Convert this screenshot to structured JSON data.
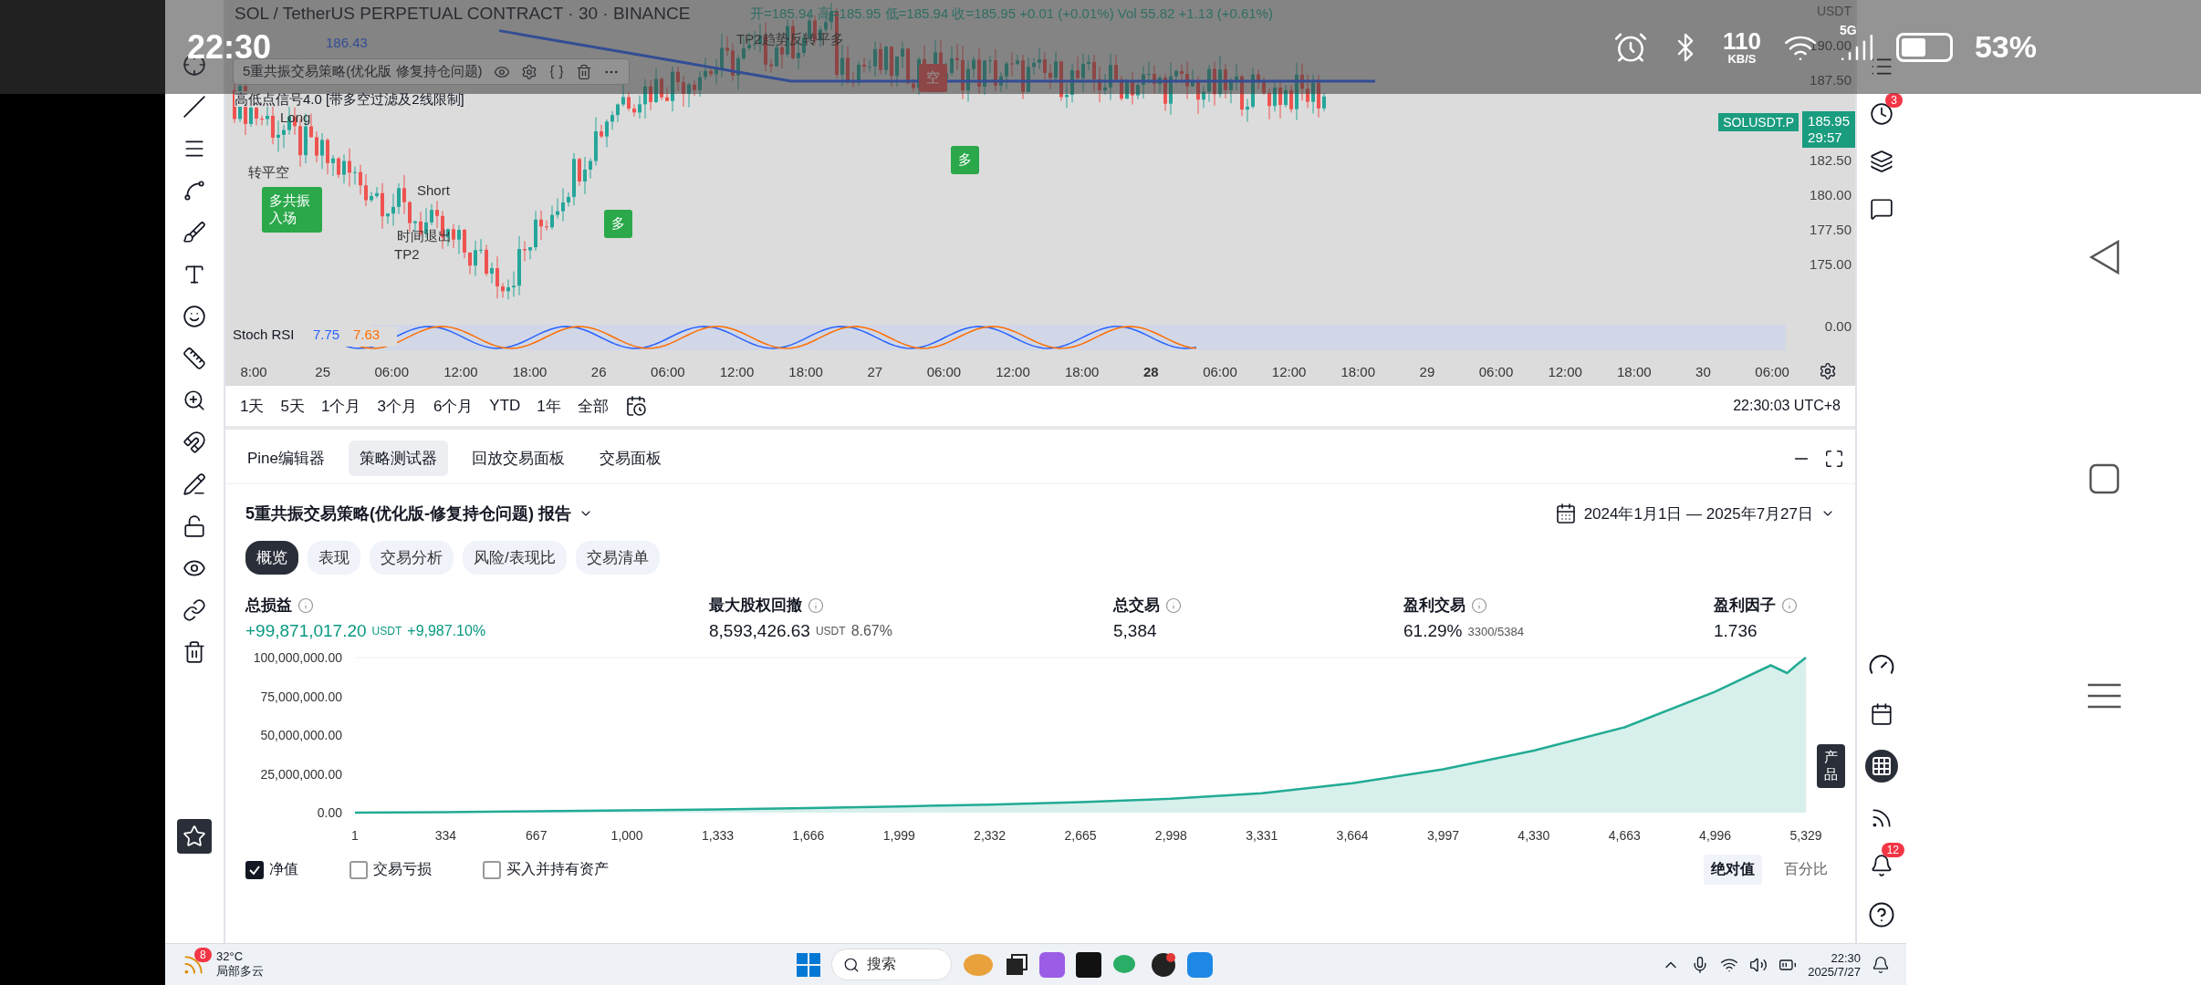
{
  "status_bar": {
    "time": "22:30",
    "speed": "110",
    "speed_unit": "KB/S",
    "network": "5G",
    "battery": "53%"
  },
  "chart": {
    "symbol": "SOL / TetherUS PERPETUAL CONTRACT · 30 · BINANCE",
    "ohlc": "开=185.94 高=185.95 低=185.94 收=185.95 +0.01 (+0.01%) Vol 55.82 +1.13 (+0.61%)",
    "ma_value": "186.43",
    "strategy_legend": "5重共振交易策略(优化版 修复持仓问题)",
    "indicator_legend": "高低点信号4.0 [带多空过滤及2线限制]",
    "signals": [
      {
        "kind": "note",
        "text": "转平空"
      },
      {
        "kind": "buy",
        "text": "多共振入场"
      },
      {
        "kind": "sell",
        "text": "空"
      },
      {
        "kind": "buy",
        "text": "多"
      },
      {
        "kind": "buy",
        "text": "多"
      },
      {
        "kind": "note",
        "text": "TP2趋势反转平多"
      },
      {
        "kind": "note",
        "text": "Long"
      },
      {
        "kind": "note",
        "text": "Short"
      },
      {
        "kind": "note",
        "text": "时间退出"
      },
      {
        "kind": "note",
        "text": "TP2"
      }
    ],
    "currency": "USDT",
    "price_labels": [
      "190.00",
      "187.50",
      "182.50",
      "180.00",
      "177.50",
      "175.00"
    ],
    "ticker": "SOLUSDT.P",
    "last_price": "185.95",
    "countdown": "29:57",
    "stoch_rsi": {
      "name": "Stoch RSI",
      "k": "7.75",
      "d": "7.63",
      "axis": "0.00"
    },
    "time_labels": [
      {
        "text": "8:00",
        "bold": false
      },
      {
        "text": "25",
        "bold": false
      },
      {
        "text": "06:00",
        "bold": false
      },
      {
        "text": "12:00",
        "bold": false
      },
      {
        "text": "18:00",
        "bold": false
      },
      {
        "text": "26",
        "bold": false
      },
      {
        "text": "06:00",
        "bold": false
      },
      {
        "text": "12:00",
        "bold": false
      },
      {
        "text": "18:00",
        "bold": false
      },
      {
        "text": "27",
        "bold": false
      },
      {
        "text": "06:00",
        "bold": false
      },
      {
        "text": "12:00",
        "bold": false
      },
      {
        "text": "18:00",
        "bold": false
      },
      {
        "text": "28",
        "bold": true
      },
      {
        "text": "06:00",
        "bold": false
      },
      {
        "text": "12:00",
        "bold": false
      },
      {
        "text": "18:00",
        "bold": false
      },
      {
        "text": "29",
        "bold": false
      },
      {
        "text": "06:00",
        "bold": false
      },
      {
        "text": "12:00",
        "bold": false
      },
      {
        "text": "18:00",
        "bold": false
      },
      {
        "text": "30",
        "bold": false
      },
      {
        "text": "06:00",
        "bold": false
      }
    ]
  },
  "range_bar": {
    "ranges": [
      "1天",
      "5天",
      "1个月",
      "3个月",
      "6个月",
      "YTD",
      "1年",
      "全部"
    ],
    "clock": "22:30:03 UTC+8"
  },
  "panel_tabs": [
    {
      "label": "Pine编辑器",
      "selected": false
    },
    {
      "label": "策略测试器",
      "selected": true
    },
    {
      "label": "回放交易面板",
      "selected": false
    },
    {
      "label": "交易面板",
      "selected": false
    }
  ],
  "report": {
    "title": "5重共振交易策略(优化版-修复持仓问题) 报告",
    "date_range": "2024年1月1日 — 2025年7月27日",
    "tabs": [
      {
        "label": "概览",
        "selected": true
      },
      {
        "label": "表现",
        "selected": false
      },
      {
        "label": "交易分析",
        "selected": false
      },
      {
        "label": "风险/表现比",
        "selected": false
      },
      {
        "label": "交易清单",
        "selected": false
      }
    ],
    "metrics": [
      {
        "label": "总损益",
        "value": "+99,871,017.20",
        "unit": "USDT",
        "extra": "+9,987.10%",
        "positive": true
      },
      {
        "label": "最大股权回撤",
        "value": "8,593,426.63",
        "unit": "USDT",
        "extra": "8.67%",
        "positive": false
      },
      {
        "label": "总交易",
        "value": "5,384",
        "positive": false
      },
      {
        "label": "盈利交易",
        "value": "61.29%",
        "extra": "3300/5384",
        "positive": false
      },
      {
        "label": "盈利因子",
        "value": "1.736",
        "positive": false
      }
    ],
    "chart_data": {
      "type": "area",
      "x": [
        1,
        334,
        667,
        1000,
        1333,
        1666,
        1999,
        2332,
        2665,
        2998,
        3331,
        3664,
        3997,
        4330,
        4663,
        4996,
        5200,
        5260,
        5300,
        5329
      ],
      "series": [
        {
          "color": "#22ab94",
          "values": [
            0,
            300000,
            900000,
            1500000,
            2100000,
            3000000,
            4000000,
            5200000,
            6800000,
            9000000,
            12500000,
            19000000,
            28000000,
            40000000,
            55000000,
            78000000,
            95000000,
            90000000,
            96000000,
            100000000
          ]
        }
      ],
      "xlim": [
        1,
        5329
      ],
      "ylim": [
        0,
        100000000
      ],
      "xticks": [
        1,
        334,
        667,
        {
          "value": 1000,
          "label": "1,000"
        },
        {
          "value": 1333,
          "label": "1,333"
        },
        {
          "value": 1666,
          "label": "1,666"
        },
        {
          "value": 1999,
          "label": "1,999"
        },
        {
          "value": 2332,
          "label": "2,332"
        },
        {
          "value": 2665,
          "label": "2,665"
        },
        {
          "value": 2998,
          "label": "2,998"
        },
        {
          "value": 3331,
          "label": "3,331"
        },
        {
          "value": 3664,
          "label": "3,664"
        },
        {
          "value": 3997,
          "label": "3,997"
        },
        {
          "value": 4330,
          "label": "4,330"
        },
        {
          "value": 4663,
          "label": "4,663"
        },
        {
          "value": 4996,
          "label": "4,996"
        },
        {
          "value": 5329,
          "label": "5,329"
        }
      ],
      "yticks": [
        {
          "value": 0,
          "label": "0.00"
        },
        {
          "value": 25000000,
          "label": "25,000,000.00"
        },
        {
          "value": 50000000,
          "label": "50,000,000.00"
        },
        {
          "value": 75000000,
          "label": "75,000,000.00"
        },
        {
          "value": 100000000,
          "label": "100,000,000.00"
        }
      ]
    },
    "legend": [
      {
        "label": "净值",
        "checked": true
      },
      {
        "label": "交易亏损",
        "checked": false
      },
      {
        "label": "买入并持有资产",
        "checked": false
      }
    ],
    "modes": [
      {
        "label": "绝对值",
        "selected": true
      },
      {
        "label": "百分比",
        "selected": false
      }
    ]
  },
  "right_toolbar": {
    "alerts_badge": "3",
    "tooltip": "产品",
    "notifications_badge": "12"
  },
  "taskbar": {
    "weather_badge": "8",
    "temperature": "32°C",
    "weather": "局部多云",
    "search": "搜索",
    "time": "22:30",
    "date": "2025/7/27"
  }
}
